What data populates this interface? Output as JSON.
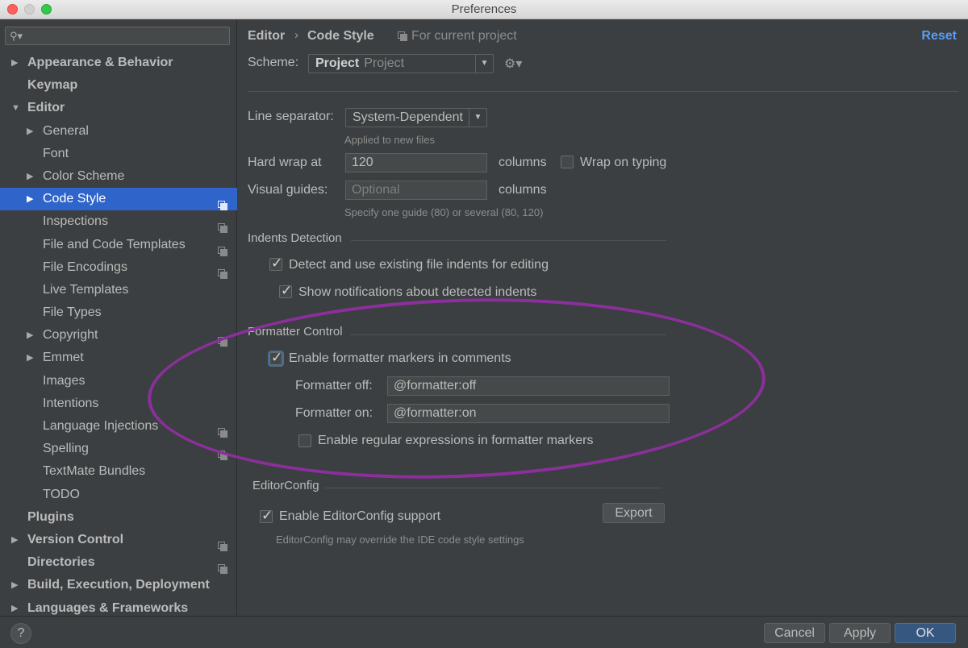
{
  "window": {
    "title": "Preferences"
  },
  "sidebar": {
    "search_placeholder": "",
    "items": [
      {
        "label": "Appearance & Behavior",
        "bold": true,
        "arrow": "▶",
        "level": 0
      },
      {
        "label": "Keymap",
        "bold": true,
        "level": 0
      },
      {
        "label": "Editor",
        "bold": true,
        "arrow": "▼",
        "level": 0
      },
      {
        "label": "General",
        "arrow": "▶",
        "level": 1
      },
      {
        "label": "Font",
        "level": 1
      },
      {
        "label": "Color Scheme",
        "arrow": "▶",
        "level": 1
      },
      {
        "label": "Code Style",
        "arrow": "▶",
        "level": 1,
        "selected": true,
        "copy": true
      },
      {
        "label": "Inspections",
        "level": 1,
        "copy": true
      },
      {
        "label": "File and Code Templates",
        "level": 1,
        "copy": true
      },
      {
        "label": "File Encodings",
        "level": 1,
        "copy": true
      },
      {
        "label": "Live Templates",
        "level": 1
      },
      {
        "label": "File Types",
        "level": 1
      },
      {
        "label": "Copyright",
        "arrow": "▶",
        "level": 1,
        "copy": true
      },
      {
        "label": "Emmet",
        "arrow": "▶",
        "level": 1
      },
      {
        "label": "Images",
        "level": 1
      },
      {
        "label": "Intentions",
        "level": 1
      },
      {
        "label": "Language Injections",
        "level": 1,
        "copy": true
      },
      {
        "label": "Spelling",
        "level": 1,
        "copy": true
      },
      {
        "label": "TextMate Bundles",
        "level": 1
      },
      {
        "label": "TODO",
        "level": 1
      },
      {
        "label": "Plugins",
        "bold": true,
        "level": 0
      },
      {
        "label": "Version Control",
        "bold": true,
        "arrow": "▶",
        "level": 0,
        "copy": true
      },
      {
        "label": "Directories",
        "bold": true,
        "level": 0,
        "copy": true
      },
      {
        "label": "Build, Execution, Deployment",
        "bold": true,
        "arrow": "▶",
        "level": 0
      },
      {
        "label": "Languages & Frameworks",
        "bold": true,
        "arrow": "▶",
        "level": 0
      }
    ]
  },
  "header": {
    "crumb1": "Editor",
    "crumb_sep": "›",
    "crumb2": "Code Style",
    "for_project": "For current project",
    "reset": "Reset"
  },
  "scheme": {
    "label": "Scheme:",
    "name": "Project",
    "sub": "Project"
  },
  "general": {
    "line_sep_label": "Line separator:",
    "line_sep_value": "System-Dependent",
    "line_sep_hint": "Applied to new files",
    "hard_wrap_label": "Hard wrap at",
    "hard_wrap_value": "120",
    "columns1": "columns",
    "wrap_on_typing": "Wrap on typing",
    "visual_guides_label": "Visual guides:",
    "visual_guides_placeholder": "Optional",
    "columns2": "columns",
    "visual_guides_hint": "Specify one guide (80) or several (80, 120)"
  },
  "indents": {
    "title": "Indents Detection",
    "detect": "Detect and use existing file indents for editing",
    "notify": "Show notifications about detected indents"
  },
  "formatter": {
    "title": "Formatter Control",
    "enable": "Enable formatter markers in comments",
    "off_label": "Formatter off:",
    "off_value": "@formatter:off",
    "on_label": "Formatter on:",
    "on_value": "@formatter:on",
    "regex": "Enable regular expressions in formatter markers"
  },
  "editorconfig": {
    "title": "EditorConfig",
    "enable": "Enable EditorConfig support",
    "export": "Export",
    "hint": "EditorConfig may override the IDE code style settings"
  },
  "footer": {
    "help": "?",
    "cancel": "Cancel",
    "apply": "Apply",
    "ok": "OK"
  },
  "colors": {
    "selection": "#2f65ca",
    "link": "#589df6",
    "annotation": "#8b2f9c"
  }
}
